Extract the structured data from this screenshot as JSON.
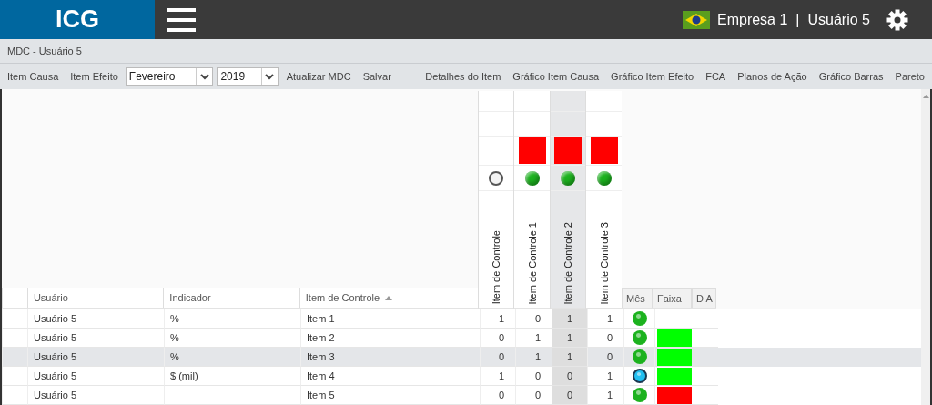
{
  "header": {
    "logo": "ICG",
    "company": "Empresa 1",
    "separator": "|",
    "user": "Usuário 5"
  },
  "breadcrumb": "MDC - Usuário 5",
  "toolbar": {
    "left": [
      {
        "kind": "link",
        "label": "Item Causa"
      },
      {
        "kind": "link",
        "label": "Item Efeito"
      },
      {
        "kind": "select",
        "value": "Fevereiro"
      },
      {
        "kind": "select",
        "value": "2019"
      },
      {
        "kind": "link",
        "label": "Atualizar MDC"
      },
      {
        "kind": "link",
        "label": "Salvar"
      }
    ],
    "right": [
      {
        "kind": "link",
        "label": "Detalhes do Item"
      },
      {
        "kind": "link",
        "label": "Gráfico Item Causa"
      },
      {
        "kind": "link",
        "label": "Gráfico Item Efeito"
      },
      {
        "kind": "link",
        "label": "FCA"
      },
      {
        "kind": "link",
        "label": "Planos de Ação"
      },
      {
        "kind": "link",
        "label": "Gráfico Barras"
      },
      {
        "kind": "link",
        "label": "Pareto"
      }
    ]
  },
  "matrix_columns": [
    {
      "label": "Item de Controle",
      "flag": false,
      "lit": false,
      "selected": false
    },
    {
      "label": "Item de Controle 1",
      "flag": true,
      "lit": true,
      "selected": false
    },
    {
      "label": "Item de Controle 2",
      "flag": true,
      "lit": true,
      "selected": true
    },
    {
      "label": "Item de Controle 3",
      "flag": true,
      "lit": true,
      "selected": false
    }
  ],
  "table": {
    "columns": [
      {
        "label": "Usuário",
        "sorted": false
      },
      {
        "label": "Indicador",
        "sorted": false
      },
      {
        "label": "Item de Controle",
        "sorted": true
      }
    ],
    "status_columns": [
      "Mês",
      "Faixa",
      "D A"
    ],
    "rows": [
      {
        "user": "Usuário 5",
        "indicator": "%",
        "item": "Item 1",
        "values": [
          "1",
          "0",
          "1",
          "1"
        ],
        "month_light": {
          "color": "#1cb21e"
        },
        "selected": false
      },
      {
        "user": "Usuário 5",
        "indicator": "%",
        "item": "Item 2",
        "values": [
          "0",
          "1",
          "1",
          "0"
        ],
        "month_light": {
          "color": "#1cb21e"
        },
        "faixa": {
          "color": "#00ff00"
        },
        "selected": false
      },
      {
        "user": "Usuário 5",
        "indicator": "%",
        "item": "Item 3",
        "values": [
          "0",
          "1",
          "1",
          "0"
        ],
        "month_light": {
          "color": "#1cb21e"
        },
        "faixa": {
          "color": "#00ff00"
        },
        "selected": true
      },
      {
        "user": "Usuário 5",
        "indicator": "$ (mil)",
        "item": "Item 4",
        "values": [
          "1",
          "0",
          "0",
          "1"
        ],
        "month_light": {
          "color": "#22bff0",
          "outlined": true
        },
        "faixa": {
          "color": "#00ff00"
        },
        "selected": false
      },
      {
        "user": "Usuário 5",
        "item": "Item 5",
        "values": [
          "0",
          "0",
          "0",
          "1"
        ],
        "month_light": {
          "color": "#1cb21e"
        },
        "faixa": {
          "color": "#ff0000"
        },
        "selected": false
      }
    ]
  }
}
